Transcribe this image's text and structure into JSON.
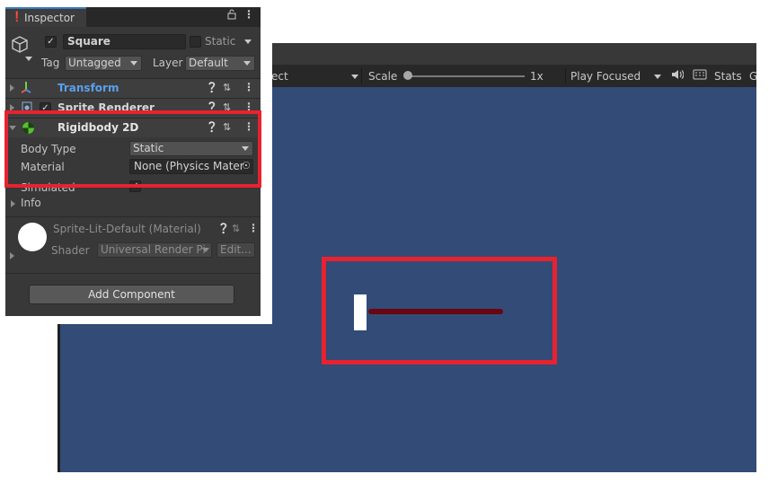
{
  "inspector": {
    "tab_label": "Inspector",
    "tab_icon": "info-icon",
    "lock_icon": "lock-icon",
    "menu_icon": "kebab-menu-icon",
    "object": {
      "name": "Square",
      "active": true,
      "static_label": "Static",
      "tag_label": "Tag",
      "tag_value": "Untagged",
      "layer_label": "Layer",
      "layer_value": "Default"
    },
    "components": [
      {
        "name": "Transform",
        "icon": "transform-icon"
      },
      {
        "name": "Sprite Renderer",
        "icon": "sprite-renderer-icon",
        "enabled": true
      },
      {
        "name": "Rigidbody 2D",
        "icon": "rigidbody2d-icon"
      }
    ],
    "rigidbody": {
      "body_type_label": "Body Type",
      "body_type_value": "Static",
      "material_label": "Material",
      "material_value": "None (Physics Mater",
      "simulated_label": "Simulated",
      "info_label": "Info"
    },
    "material": {
      "title": "Sprite-Lit-Default (Material)",
      "shader_label": "Shader",
      "shader_value": "Universal Render Pi",
      "edit_label": "Edit..."
    },
    "add_component_label": "Add Component"
  },
  "game_toolbar": {
    "aspect_fragment": "ect",
    "scale_label": "Scale",
    "scale_value": "1x",
    "play_mode": "Play Focused",
    "stats_label": "Stats",
    "gizmos_fragment": "G"
  },
  "colors": {
    "highlight_red": "#e8222f",
    "viewport_blue": "#324b77",
    "ray_dark_red": "#6b0610",
    "square_white": "#ffffff"
  }
}
